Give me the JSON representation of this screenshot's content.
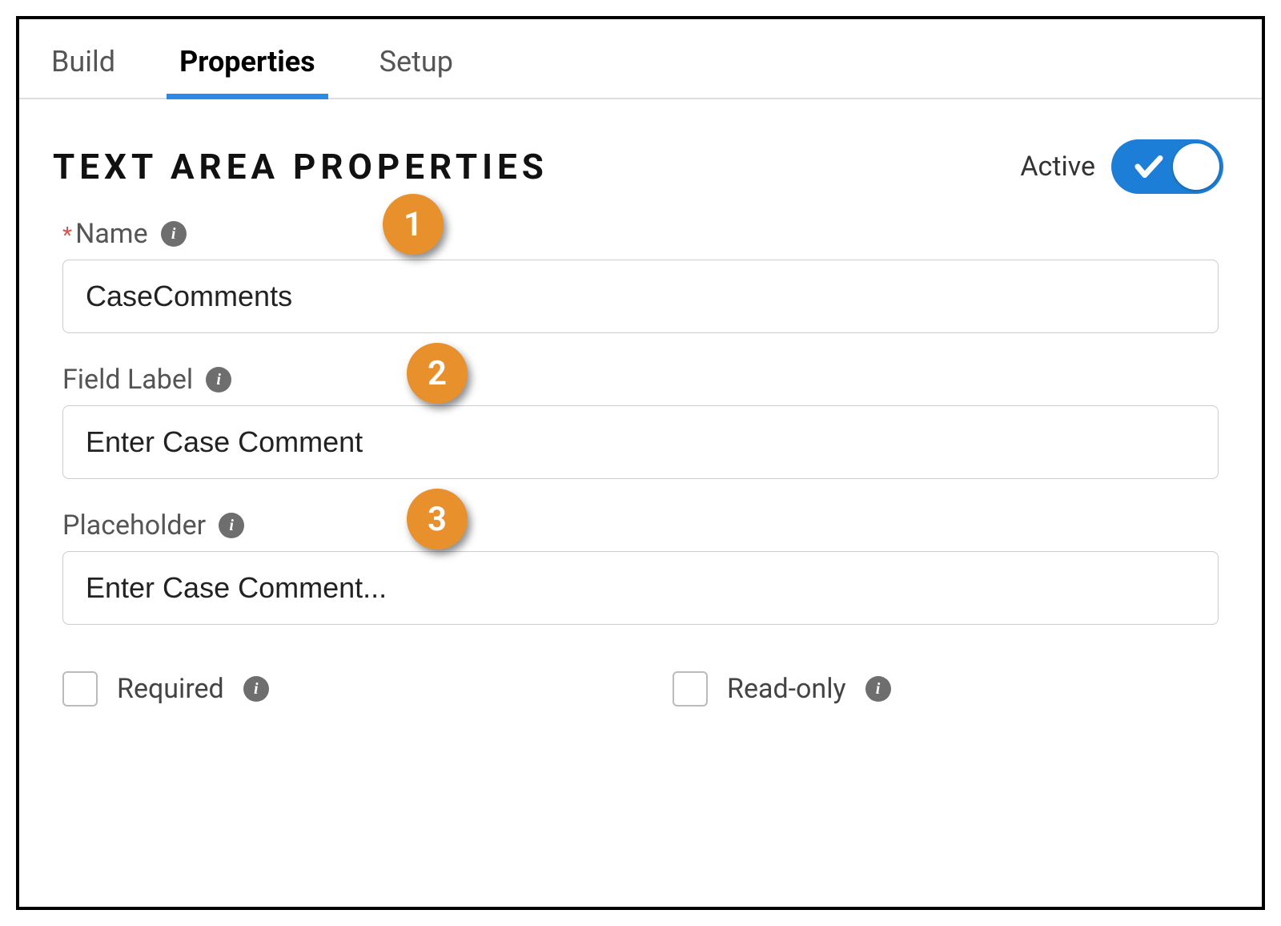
{
  "tabs": {
    "build": "Build",
    "properties": "Properties",
    "setup": "Setup"
  },
  "header": {
    "title": "TEXT AREA PROPERTIES",
    "toggle_label": "Active"
  },
  "fields": {
    "name": {
      "label": "Name",
      "value": "CaseComments",
      "required": true
    },
    "field_label": {
      "label": "Field Label",
      "value": "Enter Case Comment"
    },
    "placeholder": {
      "label": "Placeholder",
      "value": "Enter Case Comment..."
    }
  },
  "checkboxes": {
    "required": "Required",
    "readonly": "Read-only"
  },
  "callouts": {
    "one": "1",
    "two": "2",
    "three": "3"
  }
}
